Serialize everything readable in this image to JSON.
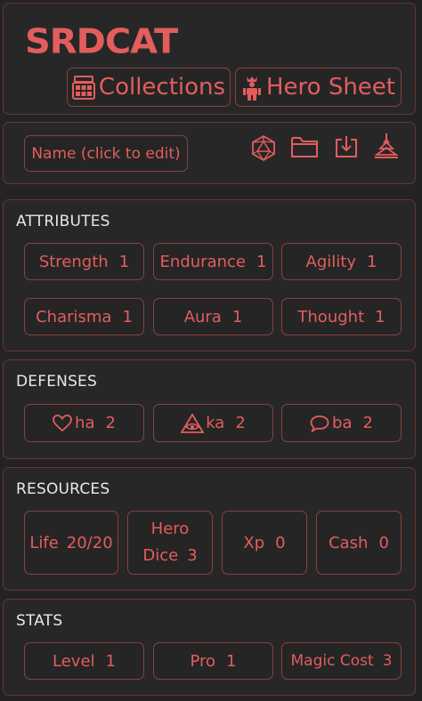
{
  "header": {
    "logo": "SRDCAT",
    "collections_label": "Collections",
    "hero_sheet_label": "Hero Sheet"
  },
  "identity": {
    "name_label": "Name (click to edit)",
    "icons": [
      "d20-icon",
      "folder-icon",
      "download-icon",
      "pagoda-icon"
    ]
  },
  "attributes": {
    "title": "ATTRIBUTES",
    "items": [
      {
        "label": "Strength",
        "value": "1"
      },
      {
        "label": "Endurance",
        "value": "1"
      },
      {
        "label": "Agility",
        "value": "1"
      },
      {
        "label": "Charisma",
        "value": "1"
      },
      {
        "label": "Aura",
        "value": "1"
      },
      {
        "label": "Thought",
        "value": "1"
      }
    ]
  },
  "defenses": {
    "title": "DEFENSES",
    "items": [
      {
        "icon": "heart-icon",
        "label": "ha",
        "value": "2"
      },
      {
        "icon": "eye-triangle-icon",
        "label": "ka",
        "value": "2"
      },
      {
        "icon": "speech-bubble-icon",
        "label": "ba",
        "value": "2"
      }
    ]
  },
  "resources": {
    "title": "RESOURCES",
    "items": [
      {
        "label": "Life",
        "value": "20/20"
      },
      {
        "label_line1": "Hero",
        "label_line2": "Dice",
        "value": "3"
      },
      {
        "label": "Xp",
        "value": "0"
      },
      {
        "label": "Cash",
        "value": "0"
      }
    ]
  },
  "stats": {
    "title": "STATS",
    "items": [
      {
        "label": "Level",
        "value": "1"
      },
      {
        "label": "Pro",
        "value": "1"
      },
      {
        "label": "Magic Cost",
        "value": "3"
      }
    ]
  },
  "colors": {
    "accent": "#e35d5d",
    "background": "#232323",
    "panel_border": "#6a3434",
    "heading_text": "#e8e8e8"
  }
}
